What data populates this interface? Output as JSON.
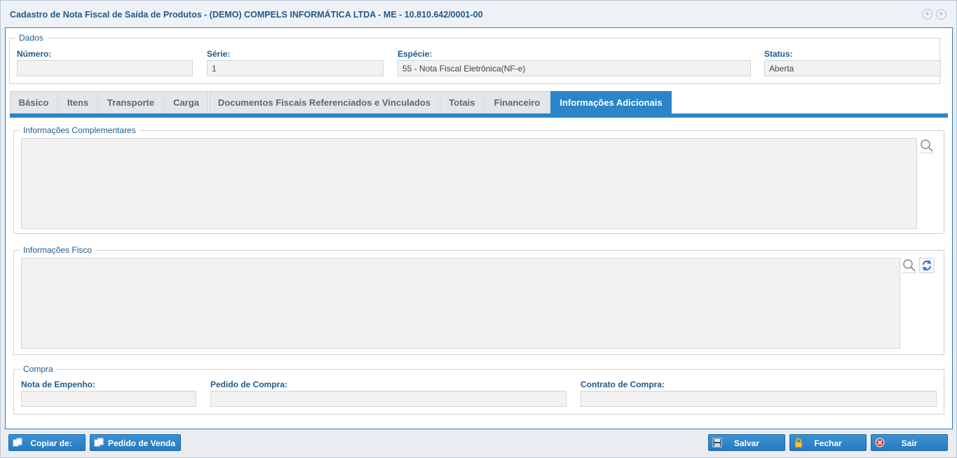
{
  "window": {
    "title": "Cadastro de Nota Fiscal de Saída de Produtos - (DEMO) COMPELS INFORMÁTICA LTDA - ME - 10.810.642/0001-00"
  },
  "dados": {
    "legend": "Dados",
    "numero": {
      "label": "Número:",
      "value": ""
    },
    "serie": {
      "label": "Série:",
      "value": "1"
    },
    "especie": {
      "label": "Espécie:",
      "value": "55 - Nota Fiscal Eletrônica(NF-e)"
    },
    "status": {
      "label": "Status:",
      "value": "Aberta"
    }
  },
  "tabs": [
    {
      "label": "Básico",
      "active": false
    },
    {
      "label": "Itens",
      "active": false
    },
    {
      "label": "Transporte",
      "active": false
    },
    {
      "label": "Carga",
      "active": false
    },
    {
      "label": "Documentos Fiscais Referenciados e Vinculados",
      "active": false
    },
    {
      "label": "Totais",
      "active": false
    },
    {
      "label": "Financeiro",
      "active": false
    },
    {
      "label": "Informações Adicionais",
      "active": true
    }
  ],
  "info_complementares": {
    "legend": "Informações Complementares",
    "value": ""
  },
  "info_fisco": {
    "legend": "Informações Fisco",
    "value": ""
  },
  "compra": {
    "legend": "Compra",
    "nota_empenho": {
      "label": "Nota de Empenho:",
      "value": ""
    },
    "pedido_compra": {
      "label": "Pedido de Compra:",
      "value": ""
    },
    "contrato_compra": {
      "label": "Contrato de Compra:",
      "value": ""
    }
  },
  "footer": {
    "copiar_label": "Copiar de:",
    "pedido_venda_label": "Pedido de Venda",
    "salvar_label": "Salvar",
    "fechar_label": "Fechar",
    "sair_label": "Sair"
  },
  "colors": {
    "accent": "#2b85c9",
    "title": "#1e5a8c",
    "input_bg": "#f2f2f2"
  }
}
